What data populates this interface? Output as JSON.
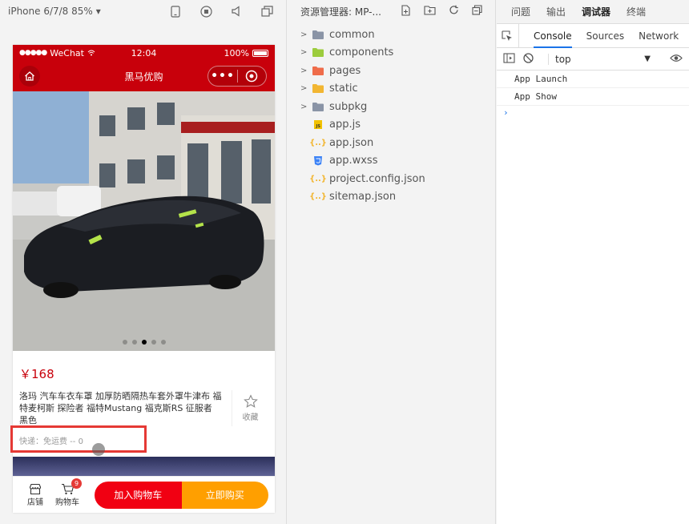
{
  "simulator": {
    "device_label": "iPhone 6/7/8 85%",
    "statusbar": {
      "carrier": "WeChat",
      "time": "12:04",
      "battery": "100%"
    },
    "navbar": {
      "title": "黑马优购"
    },
    "swiper": {
      "dot_count": 5,
      "active_index": 2
    },
    "goods": {
      "price": "￥168",
      "title": "洛玛 汽车车衣车罩 加厚防晒隔热车套外罩牛津布 福特麦柯斯 探险者 福特Mustang 福克斯RS 征服者 黑色",
      "favorite_label": "收藏",
      "shipping": "快递：免运费 -- 0"
    },
    "bottombar": {
      "shop_label": "店铺",
      "cart_label": "购物车",
      "cart_badge": "9",
      "add_cart_label": "加入购物车",
      "buy_now_label": "立即购买"
    }
  },
  "explorer": {
    "title": "资源管理器: MP-...",
    "items": [
      {
        "name": "common",
        "type": "folder",
        "color": "#8a94a6"
      },
      {
        "name": "components",
        "type": "folder",
        "color": "#9ccc3d"
      },
      {
        "name": "pages",
        "type": "folder",
        "color": "#ef6c4a"
      },
      {
        "name": "static",
        "type": "folder",
        "color": "#f2b632"
      },
      {
        "name": "subpkg",
        "type": "folder",
        "color": "#8a94a6"
      },
      {
        "name": "app.js",
        "type": "js",
        "color": "#f2c200"
      },
      {
        "name": "app.json",
        "type": "json",
        "color": "#f2b632"
      },
      {
        "name": "app.wxss",
        "type": "css",
        "color": "#3b82f6"
      },
      {
        "name": "project.config.json",
        "type": "json",
        "color": "#f2b632"
      },
      {
        "name": "sitemap.json",
        "type": "json",
        "color": "#f2b632"
      }
    ]
  },
  "devtools": {
    "top_tabs": [
      "问题",
      "输出",
      "调试器",
      "终端"
    ],
    "active_top_tab": "调试器",
    "panel_tabs": [
      "Console",
      "Sources",
      "Network"
    ],
    "active_panel_tab": "Console",
    "context": "top",
    "console_lines": [
      "App Launch",
      "App Show"
    ],
    "prompt": "›"
  }
}
